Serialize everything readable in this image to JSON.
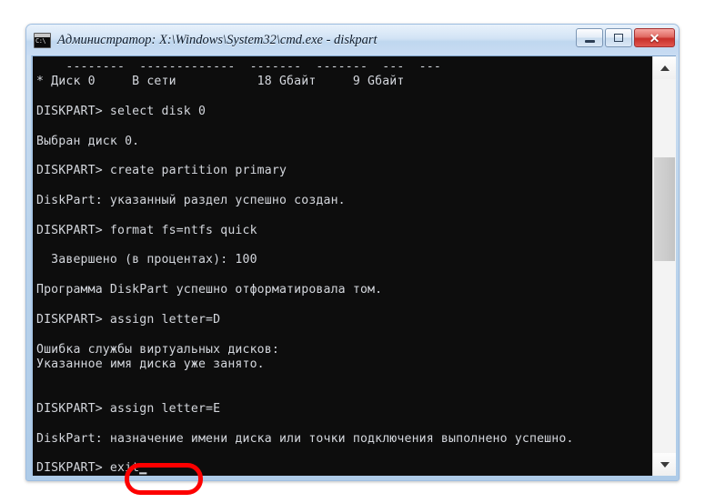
{
  "window": {
    "title": "Администратор: X:\\Windows\\System32\\cmd.exe - diskpart",
    "icon_glyph": "C:\\",
    "icon_name": "cmd-console-icon",
    "buttons": {
      "minimize_label": "—",
      "maximize_label": "",
      "close_label": "✕"
    },
    "accent_titlebar_color": "#c9dcf3",
    "close_button_color": "#c8302a",
    "console_background": "#0d0d0d",
    "console_foreground": "#d4d7dd"
  },
  "console": {
    "lines": [
      "    --------  -------------  -------  -------  ---  ---",
      "* Диск 0     В сети           18 Gбайт     9 Gбайт",
      "",
      "DISKPART> select disk 0",
      "",
      "Выбран диск 0.",
      "",
      "DISKPART> create partition primary",
      "",
      "DiskPart: указанный раздел успешно создан.",
      "",
      "DISKPART> format fs=ntfs quick",
      "",
      "  Завершено (в процентах): 100",
      "",
      "Программа DiskPart успешно отформатировала том.",
      "",
      "DISKPART> assign letter=D",
      "",
      "Ошибка службы виртуальных дисков:",
      "Указанное имя диска уже занято.",
      "",
      "",
      "DISKPART> assign letter=E",
      "",
      "DiskPart: назначение имени диска или точки подключения выполнено успешно.",
      "",
      "DISKPART> exit▁"
    ],
    "prompt": "DISKPART>",
    "current_command": "exit",
    "cursor": "▁"
  },
  "scrollbar": {
    "up_arrow_name": "scroll-up-arrow",
    "down_arrow_name": "scroll-down-arrow"
  },
  "annotation": {
    "target_text": "exit",
    "color": "#fd0000",
    "shape": "rounded-rectangle"
  }
}
